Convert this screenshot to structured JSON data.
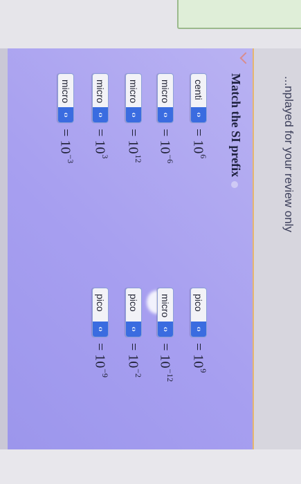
{
  "header": {
    "text": "...nplayed for your review only"
  },
  "question": {
    "title": "Match the SI prefix"
  },
  "left_column": [
    {
      "selected": "centi",
      "base": "10",
      "exponent": "6"
    },
    {
      "selected": "micro",
      "base": "10",
      "exponent": "−6"
    },
    {
      "selected": "micro",
      "base": "10",
      "exponent": "12"
    },
    {
      "selected": "micro",
      "base": "10",
      "exponent": "3"
    },
    {
      "selected": "micro",
      "base": "10",
      "exponent": "−3"
    }
  ],
  "right_column": [
    {
      "selected": "pico",
      "base": "10",
      "exponent": "9"
    },
    {
      "selected": "micro",
      "base": "10",
      "exponent": "−12"
    },
    {
      "selected": "pico",
      "base": "10",
      "exponent": "−2"
    },
    {
      "selected": "pico",
      "base": "10",
      "exponent": "−9"
    }
  ],
  "icons": {
    "dropdown": "chevron-updown-icon",
    "back": "chevron-left-icon",
    "info": "info-icon"
  },
  "colors": {
    "accent": "#3a6ce0",
    "card": "#a9a2f0",
    "header_line": "#e6b56f"
  }
}
